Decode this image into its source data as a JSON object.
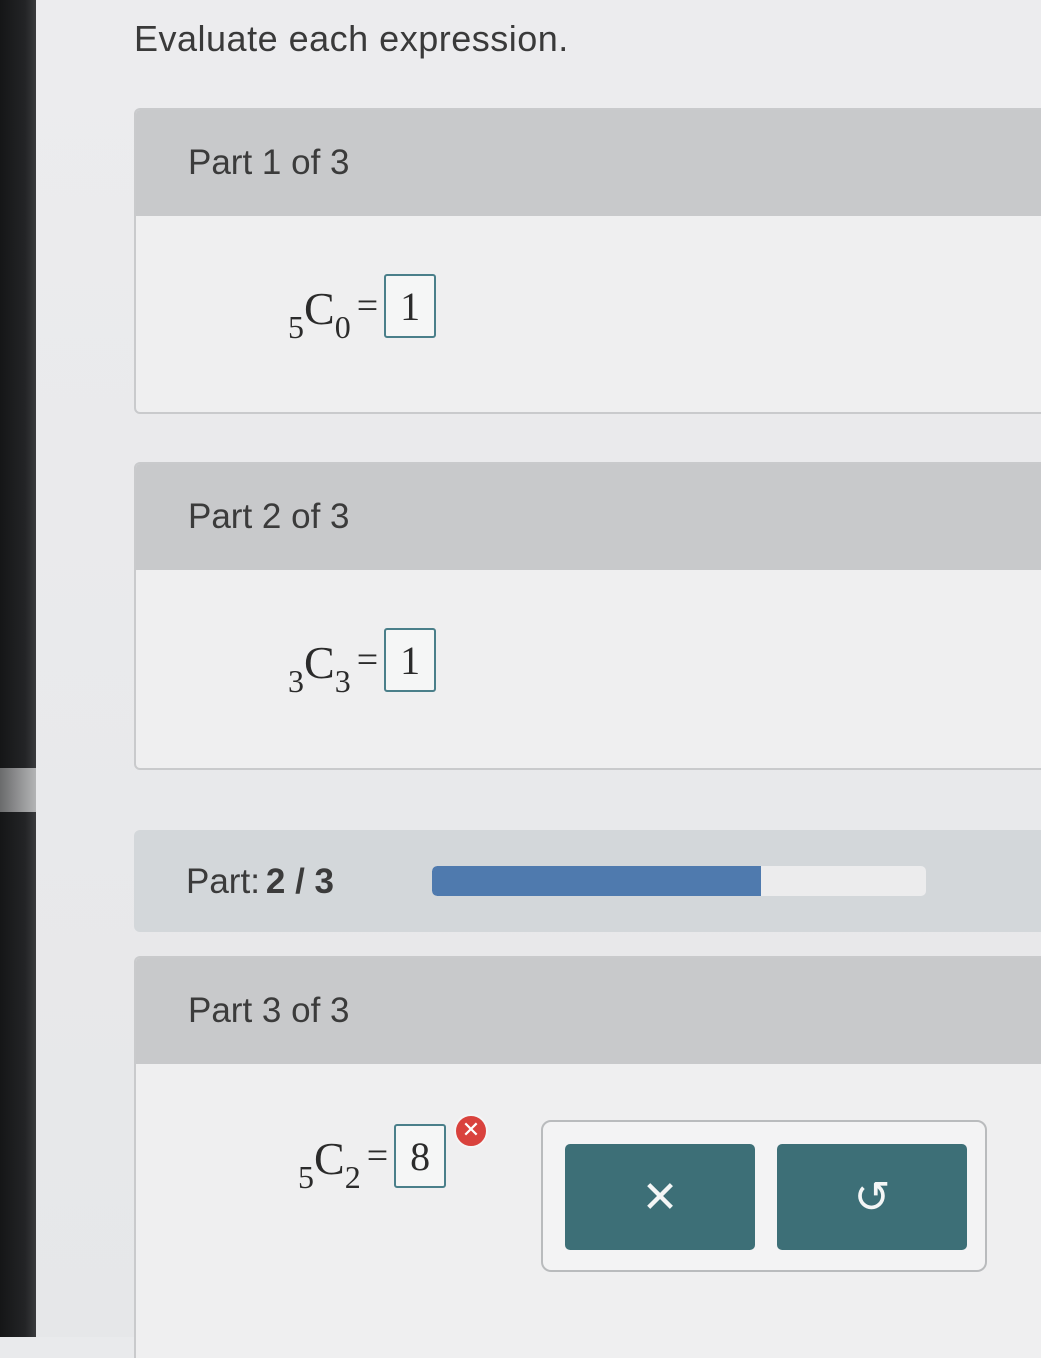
{
  "instruction": "Evaluate each expression.",
  "parts": [
    {
      "header": "Part 1 of 3",
      "n": "5",
      "letter": "C",
      "r": "0",
      "equals": "=",
      "answer": "1"
    },
    {
      "header": "Part 2 of 3",
      "n": "3",
      "letter": "C",
      "r": "3",
      "equals": "=",
      "answer": "1"
    },
    {
      "header": "Part 3 of 3",
      "n": "5",
      "letter": "C",
      "r": "2",
      "equals": "=",
      "answer": "8",
      "answer_status": "incorrect"
    }
  ],
  "progress": {
    "label": "Part:",
    "current_text": "2 / 3",
    "current": 2,
    "total": 3,
    "fill_color": "#4f7aae"
  },
  "actions": {
    "clear_glyph": "✕",
    "undo_glyph": "↺"
  },
  "icons": {
    "error_badge": "error-x-icon",
    "clear": "close-icon",
    "undo": "undo-icon"
  },
  "colors": {
    "button": "#3d6f77",
    "error": "#d9423d",
    "answer_border": "#4a7f8a"
  }
}
